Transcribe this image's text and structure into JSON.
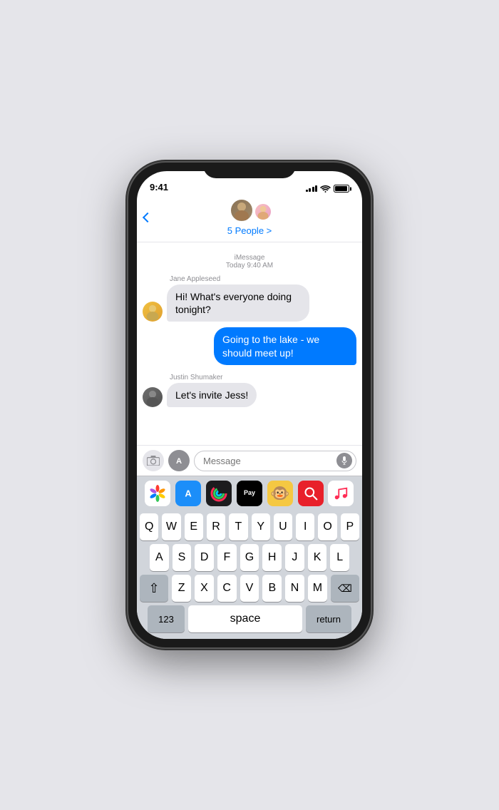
{
  "status": {
    "time": "9:41",
    "battery_level": "85%"
  },
  "header": {
    "back_label": "",
    "group_name": "5 People >",
    "avatar_emoji_main": "👨",
    "avatar_emoji_secondary": "👩"
  },
  "chat": {
    "timestamp": "iMessage\nToday 9:40 AM",
    "messages": [
      {
        "id": "msg1",
        "sender": "Jane Appleseed",
        "type": "received",
        "text": "Hi! What's everyone doing tonight?",
        "avatar": "jane"
      },
      {
        "id": "msg2",
        "sender": "me",
        "type": "sent",
        "text": "Going to the lake - we should meet up!",
        "avatar": null
      },
      {
        "id": "msg3",
        "sender": "Justin Shumaker",
        "type": "received",
        "text": "Let's invite Jess!",
        "avatar": "justin"
      }
    ]
  },
  "input": {
    "placeholder": "Message",
    "camera_label": "📷",
    "appstore_label": "A"
  },
  "app_drawer": {
    "apps": [
      {
        "name": "Photos",
        "label": "🌈"
      },
      {
        "name": "App Store",
        "label": "A"
      },
      {
        "name": "Activity",
        "label": "⬤"
      },
      {
        "name": "Apple Pay",
        "label": "Pay"
      },
      {
        "name": "Animoji",
        "label": "🐵"
      },
      {
        "name": "Safari",
        "label": "🔍"
      },
      {
        "name": "Music",
        "label": "♪"
      }
    ]
  },
  "keyboard": {
    "rows": [
      [
        "Q",
        "W",
        "E",
        "R",
        "T",
        "Y",
        "U",
        "I",
        "O",
        "P"
      ],
      [
        "A",
        "S",
        "D",
        "F",
        "G",
        "H",
        "J",
        "K",
        "L"
      ],
      [
        "Z",
        "X",
        "C",
        "V",
        "B",
        "N",
        "M"
      ]
    ],
    "special": {
      "shift": "⇧",
      "delete": "⌫",
      "numbers": "123",
      "space": "space",
      "return": "return"
    }
  }
}
